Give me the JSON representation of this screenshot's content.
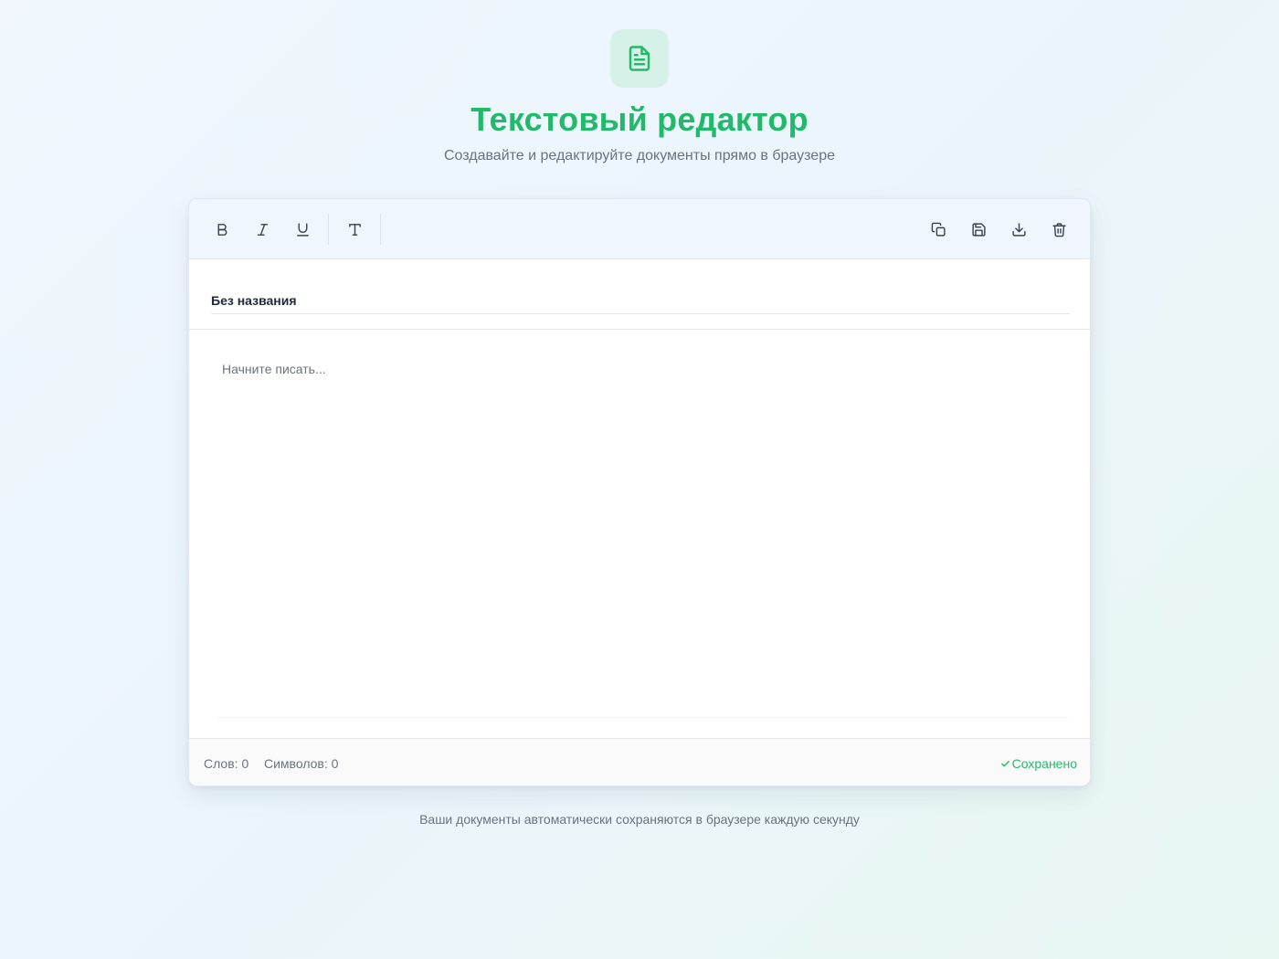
{
  "header": {
    "logo_icon": "document-icon",
    "title": "Текстовый редактор",
    "subtitle": "Создавайте и редактируйте документы прямо в браузере"
  },
  "toolbar": {
    "left_buttons": [
      "bold-icon",
      "italic-icon",
      "underline-icon",
      "text-size-icon"
    ],
    "right_buttons": [
      "copy-icon",
      "save-icon",
      "download-icon",
      "trash-icon"
    ]
  },
  "document": {
    "title_value": "Без названия",
    "body_placeholder": "Начните писать..."
  },
  "footer": {
    "words_label": "Слов:",
    "words_count": "0",
    "chars_label": "Символов:",
    "chars_count": "0",
    "saved_icon": "check-icon",
    "saved_label": "Сохранено"
  },
  "note": "Ваши документы автоматически сохраняются в браузере каждую секунду",
  "colors": {
    "accent": "#22b96b",
    "logo_bg": "#d6f2e8",
    "toolbar_bg": "#eff6fd"
  }
}
